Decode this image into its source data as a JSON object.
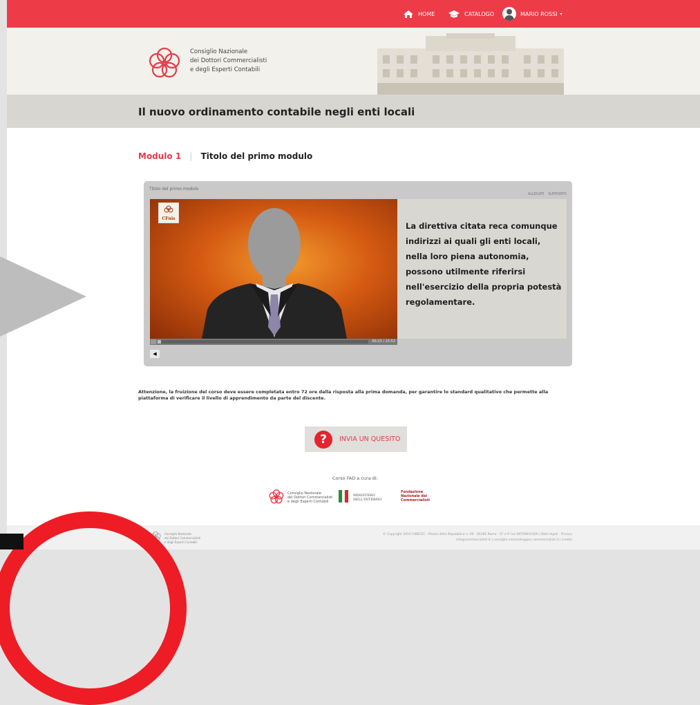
{
  "nav": {
    "home": "HOME",
    "catalog": "CATALOGO",
    "user": "MARIO ROSSI"
  },
  "org": {
    "line1": "Consiglio Nazionale",
    "line2": "dei Dottori Commercialisti",
    "line3": "e degli Esperti Contabili"
  },
  "course": {
    "title": "Il nuovo ordinamento contabile negli enti locali"
  },
  "module": {
    "number": "Modulo 1",
    "title": "Titolo del primo modulo"
  },
  "player": {
    "header": "Titolo del primo modulo",
    "tab_attachments": "ALLEGATI",
    "tab_support": "SUPPORTO",
    "logo_text": "CFnis",
    "slide_lines": [
      "La direttiva citata reca comunque",
      "indirizzi ai quali gli enti locali,",
      "nella loro piena autonomia,",
      "possono utilmente riferirsi",
      "nell'esercizio della propria potestà",
      "regolamentare."
    ],
    "time": "00:23 / 23:52",
    "progress": 0.017
  },
  "notice": "Attenzione, la fruizione del corso deve essere completata entro 72 ore dalla risposta alla prima domanda, per garantire lo standard qualitativo che permette alla piattaforma di verificare il livello di apprendimento da parte del discente.",
  "question_button": "INVIA UN QUESITO",
  "partners": {
    "label": "Corso FAD a cura di:",
    "p1_lines": [
      "Consiglio Nazionale",
      "dei Dottori Commercialisti",
      "e degli Esperti Contabili"
    ],
    "p2_lines": [
      "MINISTERO",
      "DELL'INTERNO"
    ],
    "p3_lines": [
      "Fondazione",
      "Nazionale dei",
      "Commercialisti"
    ]
  },
  "footer": {
    "org_lines": [
      "Consiglio Nazionale",
      "dei Dottori Commercialisti",
      "e degli Esperti Contabili"
    ],
    "line1": "© Copyright 2016 CNDCEC - Piazza della Repubblica n. 59 - 00185 Roma - CF e P. Iva 09758941000 | Note legali · Privacy",
    "line2": "info@commercialisti.it | consiglio.nazionale@pec.commercialisti.it | credits"
  },
  "colors": {
    "brand": "#ee3b48",
    "band": "#f3f1ec",
    "titlebar": "#d7d6d1",
    "slide_bg": "#d8d7d2"
  }
}
